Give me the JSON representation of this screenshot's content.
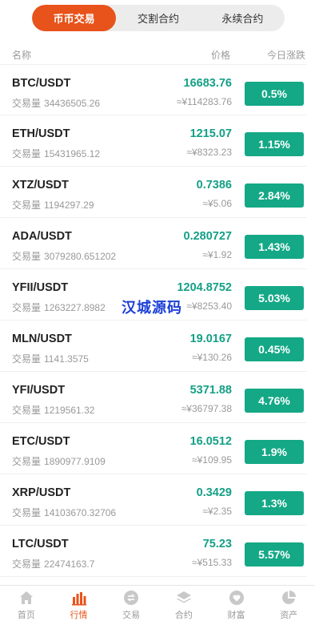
{
  "tabs": [
    {
      "label": "币币交易",
      "active": true
    },
    {
      "label": "交割合约",
      "active": false
    },
    {
      "label": "永续合约",
      "active": false
    }
  ],
  "columns": {
    "name": "名称",
    "price": "价格",
    "change": "今日涨跌"
  },
  "volume_label": "交易量",
  "rows": [
    {
      "pair": "BTC/USDT",
      "volume": "34436505.26",
      "price": "16683.76",
      "cny": "≈¥114283.76",
      "change": "0.5%"
    },
    {
      "pair": "ETH/USDT",
      "volume": "15431965.12",
      "price": "1215.07",
      "cny": "≈¥8323.23",
      "change": "1.15%"
    },
    {
      "pair": "XTZ/USDT",
      "volume": "1194297.29",
      "price": "0.7386",
      "cny": "≈¥5.06",
      "change": "2.84%"
    },
    {
      "pair": "ADA/USDT",
      "volume": "3079280.651202",
      "price": "0.280727",
      "cny": "≈¥1.92",
      "change": "1.43%"
    },
    {
      "pair": "YFII/USDT",
      "volume": "1263227.8982",
      "price": "1204.8752",
      "cny": "≈¥8253.40",
      "change": "5.03%"
    },
    {
      "pair": "MLN/USDT",
      "volume": "1141.3575",
      "price": "19.0167",
      "cny": "≈¥130.26",
      "change": "0.45%"
    },
    {
      "pair": "YFI/USDT",
      "volume": "1219561.32",
      "price": "5371.88",
      "cny": "≈¥36797.38",
      "change": "4.76%"
    },
    {
      "pair": "ETC/USDT",
      "volume": "1890977.9109",
      "price": "16.0512",
      "cny": "≈¥109.95",
      "change": "1.9%"
    },
    {
      "pair": "XRP/USDT",
      "volume": "14103670.32706",
      "price": "0.3429",
      "cny": "≈¥2.35",
      "change": "1.3%"
    },
    {
      "pair": "LTC/USDT",
      "volume": "22474163.7",
      "price": "75.23",
      "cny": "≈¥515.33",
      "change": "5.57%"
    }
  ],
  "watermark": "汉城源码",
  "tabbar": [
    {
      "label": "首页",
      "icon": "home-icon",
      "active": false
    },
    {
      "label": "行情",
      "icon": "market-chart-icon",
      "active": true
    },
    {
      "label": "交易",
      "icon": "exchange-icon",
      "active": false
    },
    {
      "label": "合约",
      "icon": "layers-icon",
      "active": false
    },
    {
      "label": "财富",
      "icon": "wealth-heart-icon",
      "active": false
    },
    {
      "label": "资产",
      "icon": "assets-pie-icon",
      "active": false
    }
  ],
  "colors": {
    "accent": "#e8531b",
    "up": "#14a886",
    "price": "#14a086",
    "muted": "#999999",
    "watermark": "#1c3fd6"
  }
}
